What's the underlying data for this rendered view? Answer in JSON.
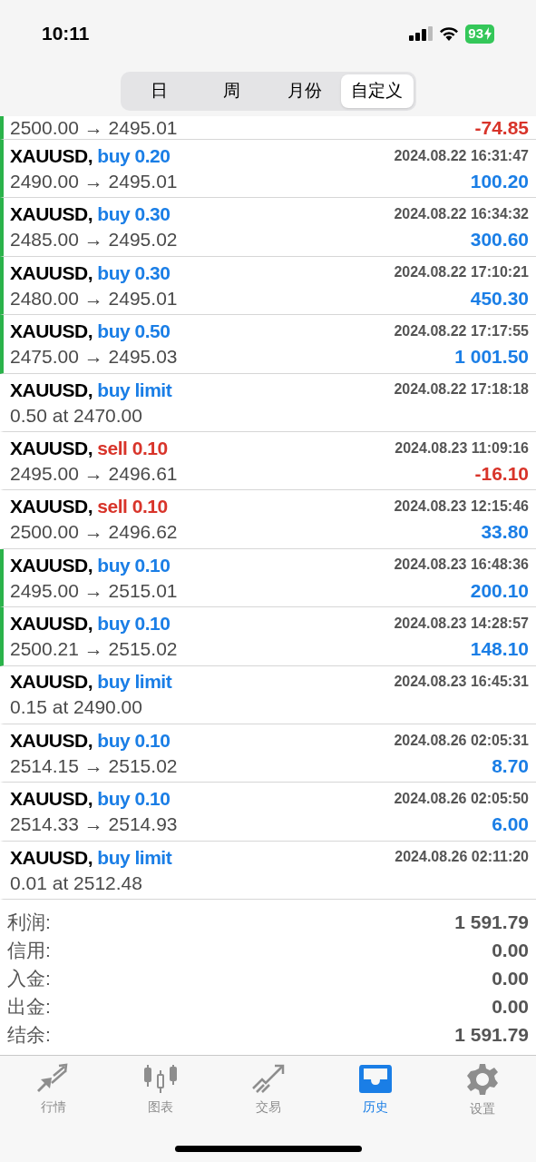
{
  "status_bar": {
    "time": "10:11",
    "battery": "93"
  },
  "period_tabs": [
    {
      "label": "日",
      "selected": false
    },
    {
      "label": "周",
      "selected": false
    },
    {
      "label": "月份",
      "selected": false
    },
    {
      "label": "自定义",
      "selected": true
    }
  ],
  "history": [
    {
      "kind": "cut",
      "marked": true,
      "detail": "2500.00 → 2495.01",
      "profit": {
        "text": "-74.85",
        "color": "#d8342a"
      }
    },
    {
      "kind": "deal",
      "marked": true,
      "symbol": "XAUUSD,",
      "order": {
        "text": "buy 0.20",
        "color": "#1a7ee6"
      },
      "time": "2024.08.22 16:31:47",
      "detail": "2490.00 → 2495.01",
      "profit": {
        "text": "100.20",
        "color": "#1a7ee6"
      }
    },
    {
      "kind": "deal",
      "marked": true,
      "symbol": "XAUUSD,",
      "order": {
        "text": "buy 0.30",
        "color": "#1a7ee6"
      },
      "time": "2024.08.22 16:34:32",
      "detail": "2485.00 → 2495.02",
      "profit": {
        "text": "300.60",
        "color": "#1a7ee6"
      }
    },
    {
      "kind": "deal",
      "marked": true,
      "symbol": "XAUUSD,",
      "order": {
        "text": "buy 0.30",
        "color": "#1a7ee6"
      },
      "time": "2024.08.22 17:10:21",
      "detail": "2480.00 → 2495.01",
      "profit": {
        "text": "450.30",
        "color": "#1a7ee6"
      }
    },
    {
      "kind": "deal",
      "marked": true,
      "symbol": "XAUUSD,",
      "order": {
        "text": "buy 0.50",
        "color": "#1a7ee6"
      },
      "time": "2024.08.22 17:17:55",
      "detail": "2475.00 → 2495.03",
      "profit": {
        "text": "1 001.50",
        "color": "#1a7ee6"
      }
    },
    {
      "kind": "order",
      "marked": false,
      "symbol": "XAUUSD,",
      "order": {
        "text": "buy limit",
        "color": "#1a7ee6"
      },
      "time": "2024.08.22 17:18:18",
      "detail": "0.50 at 2470.00"
    },
    {
      "kind": "deal",
      "marked": false,
      "symbol": "XAUUSD,",
      "order": {
        "text": "sell 0.10",
        "color": "#d8342a"
      },
      "time": "2024.08.23 11:09:16",
      "detail": "2495.00 → 2496.61",
      "profit": {
        "text": "-16.10",
        "color": "#d8342a"
      }
    },
    {
      "kind": "deal",
      "marked": false,
      "symbol": "XAUUSD,",
      "order": {
        "text": "sell 0.10",
        "color": "#d8342a"
      },
      "time": "2024.08.23 12:15:46",
      "detail": "2500.00 → 2496.62",
      "profit": {
        "text": "33.80",
        "color": "#1a7ee6"
      }
    },
    {
      "kind": "deal",
      "marked": true,
      "symbol": "XAUUSD,",
      "order": {
        "text": "buy 0.10",
        "color": "#1a7ee6"
      },
      "time": "2024.08.23 16:48:36",
      "detail": "2495.00 → 2515.01",
      "profit": {
        "text": "200.10",
        "color": "#1a7ee6"
      }
    },
    {
      "kind": "deal",
      "marked": true,
      "symbol": "XAUUSD,",
      "order": {
        "text": "buy 0.10",
        "color": "#1a7ee6"
      },
      "time": "2024.08.23 14:28:57",
      "detail": "2500.21 → 2515.02",
      "profit": {
        "text": "148.10",
        "color": "#1a7ee6"
      }
    },
    {
      "kind": "order",
      "marked": false,
      "symbol": "XAUUSD,",
      "order": {
        "text": "buy limit",
        "color": "#1a7ee6"
      },
      "time": "2024.08.23 16:45:31",
      "detail": "0.15 at 2490.00"
    },
    {
      "kind": "deal",
      "marked": false,
      "symbol": "XAUUSD,",
      "order": {
        "text": "buy 0.10",
        "color": "#1a7ee6"
      },
      "time": "2024.08.26 02:05:31",
      "detail": "2514.15 → 2515.02",
      "profit": {
        "text": "8.70",
        "color": "#1a7ee6"
      }
    },
    {
      "kind": "deal",
      "marked": false,
      "symbol": "XAUUSD,",
      "order": {
        "text": "buy 0.10",
        "color": "#1a7ee6"
      },
      "time": "2024.08.26 02:05:50",
      "detail": "2514.33 → 2514.93",
      "profit": {
        "text": "6.00",
        "color": "#1a7ee6"
      }
    },
    {
      "kind": "order",
      "marked": false,
      "symbol": "XAUUSD,",
      "order": {
        "text": "buy limit",
        "color": "#1a7ee6"
      },
      "time": "2024.08.26 02:11:20",
      "detail": "0.01 at 2512.48"
    }
  ],
  "summary": [
    {
      "label": "利润:",
      "value": "1 591.79"
    },
    {
      "label": "信用:",
      "value": "0.00"
    },
    {
      "label": "入金:",
      "value": "0.00"
    },
    {
      "label": "出金:",
      "value": "0.00"
    },
    {
      "label": "结余:",
      "value": "1 591.79"
    }
  ],
  "bottom_tabs": [
    {
      "label": "行情",
      "selected": false
    },
    {
      "label": "图表",
      "selected": false
    },
    {
      "label": "交易",
      "selected": false
    },
    {
      "label": "历史",
      "selected": true
    },
    {
      "label": "设置",
      "selected": false
    }
  ]
}
